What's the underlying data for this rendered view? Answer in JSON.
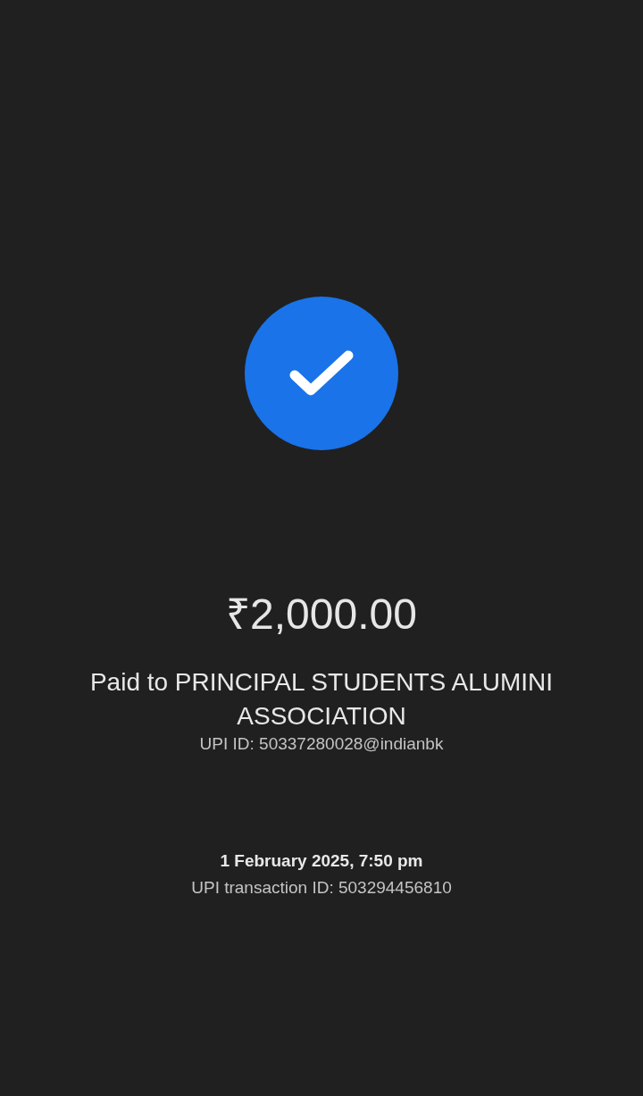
{
  "status": {
    "kind": "success"
  },
  "amount": "₹2,000.00",
  "payee": "Paid to PRINCIPAL STUDENTS ALUMINI ASSOCIATION",
  "upi_id": "UPI ID: 50337280028@indianbk",
  "datetime": "1 February 2025, 7:50 pm",
  "transaction_id": "UPI transaction ID: 503294456810"
}
